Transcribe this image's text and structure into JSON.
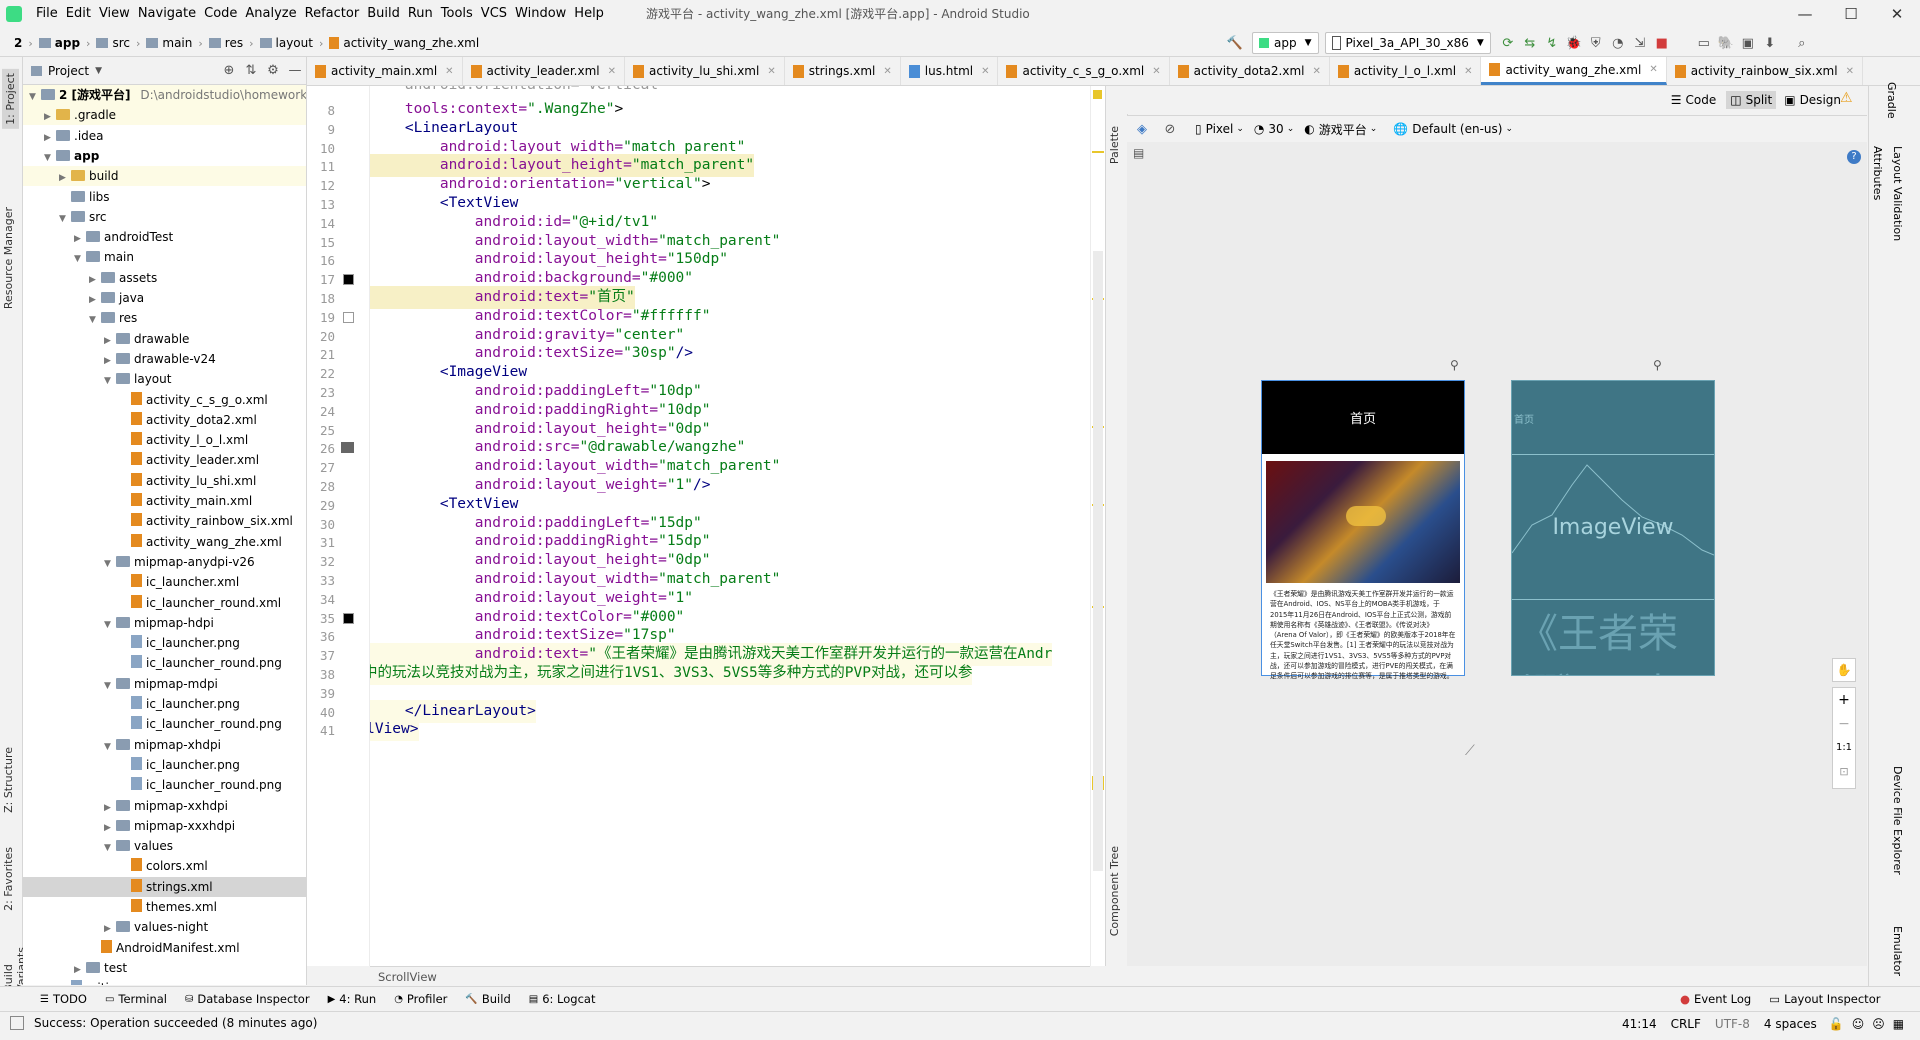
{
  "menu": [
    "File",
    "Edit",
    "View",
    "Navigate",
    "Code",
    "Analyze",
    "Refactor",
    "Build",
    "Run",
    "Tools",
    "VCS",
    "Window",
    "Help"
  ],
  "window_title": "游戏平台 - activity_wang_zhe.xml [游戏平台.app] - Android Studio",
  "breadcrumb": [
    "2",
    "app",
    "src",
    "main",
    "res",
    "layout",
    "activity_wang_zhe.xml"
  ],
  "run_config": "app",
  "device": "Pixel_3a_API_30_x86",
  "project_panel": {
    "title": "Project",
    "root_label": "2 [游戏平台]",
    "root_path": "D:\\androidstudio\\homework"
  },
  "tree": [
    {
      "label": ".gradle",
      "level": 1,
      "arrow": "▶",
      "icon": "folder-y"
    },
    {
      "label": ".idea",
      "level": 1,
      "arrow": "▶",
      "icon": "folder"
    },
    {
      "label": "app",
      "level": 1,
      "arrow": "▼",
      "icon": "folder",
      "bold": true
    },
    {
      "label": "build",
      "level": 2,
      "arrow": "▶",
      "icon": "folder-y"
    },
    {
      "label": "libs",
      "level": 2,
      "arrow": "",
      "icon": "folder"
    },
    {
      "label": "src",
      "level": 2,
      "arrow": "▼",
      "icon": "folder"
    },
    {
      "label": "androidTest",
      "level": 3,
      "arrow": "▶",
      "icon": "folder"
    },
    {
      "label": "main",
      "level": 3,
      "arrow": "▼",
      "icon": "folder"
    },
    {
      "label": "assets",
      "level": 4,
      "arrow": "▶",
      "icon": "folder"
    },
    {
      "label": "java",
      "level": 4,
      "arrow": "▶",
      "icon": "folder"
    },
    {
      "label": "res",
      "level": 4,
      "arrow": "▼",
      "icon": "folder"
    },
    {
      "label": "drawable",
      "level": 5,
      "arrow": "▶",
      "icon": "folder"
    },
    {
      "label": "drawable-v24",
      "level": 5,
      "arrow": "▶",
      "icon": "folder"
    },
    {
      "label": "layout",
      "level": 5,
      "arrow": "▼",
      "icon": "folder"
    },
    {
      "label": "activity_c_s_g_o.xml",
      "level": 6,
      "arrow": "",
      "icon": "xmlf"
    },
    {
      "label": "activity_dota2.xml",
      "level": 6,
      "arrow": "",
      "icon": "xmlf"
    },
    {
      "label": "activity_l_o_l.xml",
      "level": 6,
      "arrow": "",
      "icon": "xmlf"
    },
    {
      "label": "activity_leader.xml",
      "level": 6,
      "arrow": "",
      "icon": "xmlf"
    },
    {
      "label": "activity_lu_shi.xml",
      "level": 6,
      "arrow": "",
      "icon": "xmlf"
    },
    {
      "label": "activity_main.xml",
      "level": 6,
      "arrow": "",
      "icon": "xmlf"
    },
    {
      "label": "activity_rainbow_six.xml",
      "level": 6,
      "arrow": "",
      "icon": "xmlf"
    },
    {
      "label": "activity_wang_zhe.xml",
      "level": 6,
      "arrow": "",
      "icon": "xmlf"
    },
    {
      "label": "mipmap-anydpi-v26",
      "level": 5,
      "arrow": "▼",
      "icon": "folder"
    },
    {
      "label": "ic_launcher.xml",
      "level": 6,
      "arrow": "",
      "icon": "xmlf"
    },
    {
      "label": "ic_launcher_round.xml",
      "level": 6,
      "arrow": "",
      "icon": "xmlf"
    },
    {
      "label": "mipmap-hdpi",
      "level": 5,
      "arrow": "▼",
      "icon": "folder"
    },
    {
      "label": "ic_launcher.png",
      "level": 6,
      "arrow": "",
      "icon": "pngf"
    },
    {
      "label": "ic_launcher_round.png",
      "level": 6,
      "arrow": "",
      "icon": "pngf"
    },
    {
      "label": "mipmap-mdpi",
      "level": 5,
      "arrow": "▼",
      "icon": "folder"
    },
    {
      "label": "ic_launcher.png",
      "level": 6,
      "arrow": "",
      "icon": "pngf"
    },
    {
      "label": "ic_launcher_round.png",
      "level": 6,
      "arrow": "",
      "icon": "pngf"
    },
    {
      "label": "mipmap-xhdpi",
      "level": 5,
      "arrow": "▼",
      "icon": "folder"
    },
    {
      "label": "ic_launcher.png",
      "level": 6,
      "arrow": "",
      "icon": "pngf"
    },
    {
      "label": "ic_launcher_round.png",
      "level": 6,
      "arrow": "",
      "icon": "pngf"
    },
    {
      "label": "mipmap-xxhdpi",
      "level": 5,
      "arrow": "▶",
      "icon": "folder"
    },
    {
      "label": "mipmap-xxxhdpi",
      "level": 5,
      "arrow": "▶",
      "icon": "folder"
    },
    {
      "label": "values",
      "level": 5,
      "arrow": "▼",
      "icon": "folder"
    },
    {
      "label": "colors.xml",
      "level": 6,
      "arrow": "",
      "icon": "xmlf"
    },
    {
      "label": "strings.xml",
      "level": 6,
      "arrow": "",
      "icon": "xmlf",
      "selected": true
    },
    {
      "label": "themes.xml",
      "level": 6,
      "arrow": "",
      "icon": "xmlf"
    },
    {
      "label": "values-night",
      "level": 5,
      "arrow": "▶",
      "icon": "folder"
    },
    {
      "label": "AndroidManifest.xml",
      "level": 4,
      "arrow": "",
      "icon": "xmlf"
    },
    {
      "label": "test",
      "level": 3,
      "arrow": "▶",
      "icon": "folder"
    },
    {
      "label": ".gitignore",
      "level": 2,
      "arrow": "",
      "icon": "pngf"
    }
  ],
  "editor_tabs": [
    {
      "label": "activity_main.xml",
      "active": false
    },
    {
      "label": "activity_leader.xml",
      "active": false
    },
    {
      "label": "activity_lu_shi.xml",
      "active": false
    },
    {
      "label": "strings.xml",
      "active": false
    },
    {
      "label": "lus.html",
      "active": false
    },
    {
      "label": "activity_c_s_g_o.xml",
      "active": false
    },
    {
      "label": "activity_dota2.xml",
      "active": false
    },
    {
      "label": "activity_l_o_l.xml",
      "active": false
    },
    {
      "label": "activity_wang_zhe.xml",
      "active": true
    },
    {
      "label": "activity_rainbow_six.xml",
      "active": false
    }
  ],
  "code_start_line": 8,
  "code_lines": [
    [
      [
        "attr",
        "    tools:context="
      ],
      [
        "val",
        "\".WangZhe\""
      ],
      [
        "sc",
        ">"
      ]
    ],
    [
      [
        "sc",
        "    "
      ],
      [
        "tag",
        "<LinearLayout"
      ]
    ],
    [
      [
        "attr",
        "        android:layout_width="
      ],
      [
        "val",
        "\"match_parent\""
      ]
    ],
    [
      [
        "attr",
        "        android:layout_height="
      ],
      [
        "val",
        "\"match_parent\""
      ]
    ],
    [
      [
        "attr",
        "        android:orientation="
      ],
      [
        "val",
        "\"vertical\""
      ],
      [
        "sc",
        ">"
      ]
    ],
    [
      [
        "sc",
        "        "
      ],
      [
        "tag",
        "<TextView"
      ]
    ],
    [
      [
        "attr",
        "            android:id="
      ],
      [
        "val",
        "\"@+id/tv1\""
      ]
    ],
    [
      [
        "attr",
        "            android:layout_width="
      ],
      [
        "val",
        "\"match_parent\""
      ]
    ],
    [
      [
        "attr",
        "            android:layout_height="
      ],
      [
        "val",
        "\"150dp\""
      ]
    ],
    [
      [
        "attr",
        "            android:background="
      ],
      [
        "val",
        "\"#000\""
      ]
    ],
    [
      [
        "attr",
        "            android:text="
      ],
      [
        "val",
        "\"首页\""
      ]
    ],
    [
      [
        "attr",
        "            android:textColor="
      ],
      [
        "val",
        "\"#ffffff\""
      ]
    ],
    [
      [
        "attr",
        "            android:gravity="
      ],
      [
        "val",
        "\"center\""
      ]
    ],
    [
      [
        "attr",
        "            android:textSize="
      ],
      [
        "val",
        "\"30sp\""
      ],
      [
        "tag",
        "/>"
      ]
    ],
    [
      [
        "sc",
        "        "
      ],
      [
        "tag",
        "<ImageView"
      ]
    ],
    [
      [
        "attr",
        "            android:paddingLeft="
      ],
      [
        "val",
        "\"10dp\""
      ]
    ],
    [
      [
        "attr",
        "            android:paddingRight="
      ],
      [
        "val",
        "\"10dp\""
      ]
    ],
    [
      [
        "attr",
        "            android:layout_height="
      ],
      [
        "val",
        "\"0dp\""
      ]
    ],
    [
      [
        "attr",
        "            android:src="
      ],
      [
        "val",
        "\"@drawable/wangzhe\""
      ]
    ],
    [
      [
        "attr",
        "            android:layout_width="
      ],
      [
        "val",
        "\"match_parent\""
      ]
    ],
    [
      [
        "attr",
        "            android:layout_weight="
      ],
      [
        "val",
        "\"1\""
      ],
      [
        "tag",
        "/>"
      ]
    ],
    [
      [
        "sc",
        "        "
      ],
      [
        "tag",
        "<TextView"
      ]
    ],
    [
      [
        "attr",
        "            android:paddingLeft="
      ],
      [
        "val",
        "\"15dp\""
      ]
    ],
    [
      [
        "attr",
        "            android:paddingRight="
      ],
      [
        "val",
        "\"15dp\""
      ]
    ],
    [
      [
        "attr",
        "            android:layout_height="
      ],
      [
        "val",
        "\"0dp\""
      ]
    ],
    [
      [
        "attr",
        "            android:layout_width="
      ],
      [
        "val",
        "\"match_parent\""
      ]
    ],
    [
      [
        "attr",
        "            android:layout_weight="
      ],
      [
        "val",
        "\"1\""
      ]
    ],
    [
      [
        "attr",
        "            android:textColor="
      ],
      [
        "val",
        "\"#000\""
      ]
    ],
    [
      [
        "attr",
        "            android:textSize="
      ],
      [
        "val",
        "\"17sp\""
      ]
    ],
    [
      [
        "attr",
        "            android:text="
      ],
      [
        "val",
        "\"《王者荣耀》是由腾讯游戏天美工作室群开发并运行的一款运营在Andr"
      ]
    ],
    [
      [
        "val",
        "王者荣耀中的玩法以竞技对战为主，玩家之间进行1VS1、3VS3、5VS5等多种方式的PVP对战，还可以参"
      ]
    ],
    [
      [
        "sc",
        ""
      ]
    ],
    [
      [
        "sc",
        "    "
      ],
      [
        "tag",
        "</LinearLayout>"
      ]
    ],
    [
      [
        "tag",
        "</ScrollView>"
      ]
    ]
  ],
  "scroll_crumb": "ScrollView",
  "view_modes": [
    "Code",
    "Split",
    "Design"
  ],
  "design_toolbar": {
    "device": "Pixel",
    "api": "30",
    "theme": "游戏平台",
    "locale": "Default (en-us)"
  },
  "preview": {
    "header_text": "首页",
    "body_text": "《王者荣耀》是由腾讯游戏天美工作室群开发并运行的一款运营在Android、IOS、NS平台上的MOBA类手机游戏，于2015年11月26日在Android、IOS平台上正式公测，游戏前期使用名称有《英雄战迹》、《王者联盟》。《传说对决》（Arena Of Valor），即《王者荣耀》的欧美版本于2018年在任天堂Switch平台发售。[1] 王者荣耀中的玩法以竞技对战为主，玩家之间进行1VS1、3VS3、5VS5等多种方式的PVP对战，还可以参加游戏的冒险模式，进行PVE的闯关模式，在满足条件后可以参加游戏的排位赛等，是属于推塔类型的游戏。",
    "blueprint_header": "首页",
    "blueprint_image_label": "ImageView",
    "blueprint_text": "《王者荣耀》是由"
  },
  "zoom_label": "1:1",
  "left_stripe_tabs": [
    "1: Project",
    "Resource Manager",
    "Z: Structure",
    "2: Favorites",
    "Build Variants"
  ],
  "right_stripe_tabs": [
    "Gradle",
    "Attributes",
    "Layout Validation",
    "Device File Explorer",
    "Emulator"
  ],
  "ct_strip_tabs": [
    "Palette",
    "Component Tree"
  ],
  "bottom_tabs": [
    "TODO",
    "Terminal",
    "Database Inspector",
    "4: Run",
    "Profiler",
    "Build",
    "6: Logcat"
  ],
  "bottom_right_tabs": [
    "Event Log",
    "Layout Inspector"
  ],
  "status": {
    "message": "Success: Operation succeeded (8 minutes ago)",
    "position": "41:14",
    "line_sep": "CRLF",
    "encoding": "UTF-8",
    "indent": "4 spaces"
  }
}
